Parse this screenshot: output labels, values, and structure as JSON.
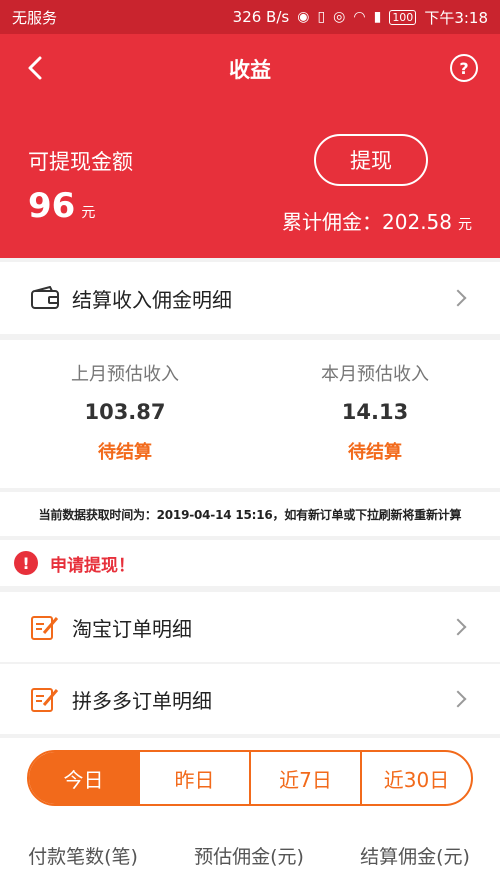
{
  "status_bar": {
    "carrier": "无服务",
    "speed": "326 B/s",
    "battery": "100",
    "time": "下午3:18",
    "icons": [
      "nfc-icon",
      "vibrate-icon",
      "eye-icon",
      "wifi-icon",
      "sim-alert-icon",
      "battery-icon"
    ]
  },
  "nav": {
    "title": "收益",
    "help": "?"
  },
  "earnings": {
    "available_label": "可提现金额",
    "available_amount": "96",
    "available_unit": "元",
    "withdraw_label": "提现",
    "total_label": "累计佣金：",
    "total_amount": "202.58",
    "total_unit": "元"
  },
  "settlement_detail": {
    "label": "结算收入佣金明细"
  },
  "stats": {
    "last_month": {
      "title": "上月预估收入",
      "value": "103.87",
      "status": "待结算"
    },
    "this_month": {
      "title": "本月预估收入",
      "value": "14.13",
      "status": "待结算"
    }
  },
  "timestamp_note": "当前数据获取时间为：2019-04-14 15:16，如有新订单或下拉刷新将重新计算",
  "alert": {
    "icon": "!",
    "text": "申请提现！"
  },
  "orders": [
    {
      "label": "淘宝订单明细"
    },
    {
      "label": "拼多多订单明细"
    }
  ],
  "period_tabs": [
    {
      "label": "今日",
      "active": true
    },
    {
      "label": "昨日",
      "active": false
    },
    {
      "label": "近7日",
      "active": false
    },
    {
      "label": "近30日",
      "active": false
    }
  ],
  "columns": [
    "付款笔数(笔)",
    "预估佣金(元)",
    "结算佣金(元)"
  ],
  "colors": {
    "primary_red": "#e7303b",
    "accent_orange": "#f26a1b"
  }
}
